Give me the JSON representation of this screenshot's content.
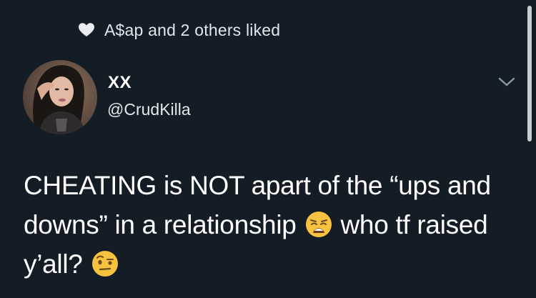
{
  "liked_by": {
    "text": "A$ap and 2 others liked"
  },
  "author": {
    "display_name": "XX",
    "handle": "@CrudKilla"
  },
  "tweet": {
    "text_part1": "CHEATING is NOT apart of the “ups and downs” in a relationship",
    "text_part2": "who tf raised y’all?",
    "emoji1": "weary-face-emoji",
    "emoji2": "face-with-raised-eyebrow-emoji"
  },
  "icons": {
    "heart": "heart-icon",
    "chevron": "chevron-down-icon"
  },
  "colors": {
    "background": "#141d26",
    "text_primary": "#ffffff",
    "text_secondary": "#dfe6ec"
  }
}
